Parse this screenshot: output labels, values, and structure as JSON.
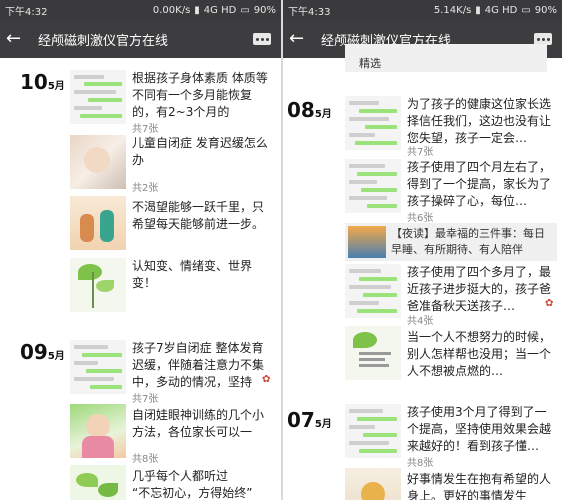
{
  "left": {
    "status": {
      "time": "下午4:32",
      "speed": "0.00K/s",
      "network": "4G HD",
      "battery": "90%"
    },
    "title": "经颅磁刺激仪官方在线",
    "groups": [
      {
        "day": "10",
        "month": "5月",
        "items": [
          {
            "text": "根据孩子身体素质 体质等不同有一个多月能恢复的，有2~3个月的",
            "count": "共7张"
          },
          {
            "text": "儿童自闭症 发育迟缓怎么办",
            "count": "共2张"
          },
          {
            "text": "不渴望能够一跃千里，只希望每天能够前进一步。",
            "count": ""
          },
          {
            "text": "认知变、情绪变、世界变！\n\n面对身上的光环时，我们…",
            "count": ""
          }
        ]
      },
      {
        "day": "09",
        "month": "5月",
        "items": [
          {
            "text": "孩子7岁自闭症 整体发育迟缓，伴随着注意力不集中，多动的情况，坚持使…",
            "count": "共7张"
          },
          {
            "text": "自闭娃眼神训练的几个小方法，各位家长可以一试…",
            "count": "共8张"
          },
          {
            "text": "几乎每个人都听过\n“不忘初心，方得始终”",
            "count": ""
          }
        ]
      }
    ]
  },
  "right": {
    "status": {
      "time": "下午4:33",
      "speed": "5.14K/s",
      "network": "4G HD",
      "battery": "90%"
    },
    "title": "经颅磁刺激仪官方在线",
    "top_label": "精选",
    "groups": [
      {
        "day": "08",
        "month": "5月",
        "items": [
          {
            "text": "为了孩子的健康这位家长选择信任我们，这边也没有让您失望，孩子一定会…",
            "count": "共7张"
          },
          {
            "text": "孩子使用了四个月左右了，得到了一个提高，家长为了孩子操碎了心，每位…",
            "count": "共6张"
          },
          {
            "text": "【夜读】最幸福的三件事：每日早睡、有所期待、有人陪伴",
            "count": ""
          },
          {
            "text": "孩子使用了四个多月了，最近孩子进步挺大的，孩子爸爸准备秋天送孩子…",
            "count": "共4张"
          },
          {
            "text": "当一个人不想努力的时候，别人怎样帮也没用；当一个人不想被点燃的…",
            "count": ""
          }
        ]
      },
      {
        "day": "07",
        "month": "5月",
        "items": [
          {
            "text": "孩子使用3个月了得到了一个提高，坚持使用效果会越来越好的！看到孩子懂…",
            "count": "共8张"
          },
          {
            "text": "好事情发生在抱有希望的人身上。更好的事情发生",
            "count": ""
          }
        ]
      }
    ]
  }
}
